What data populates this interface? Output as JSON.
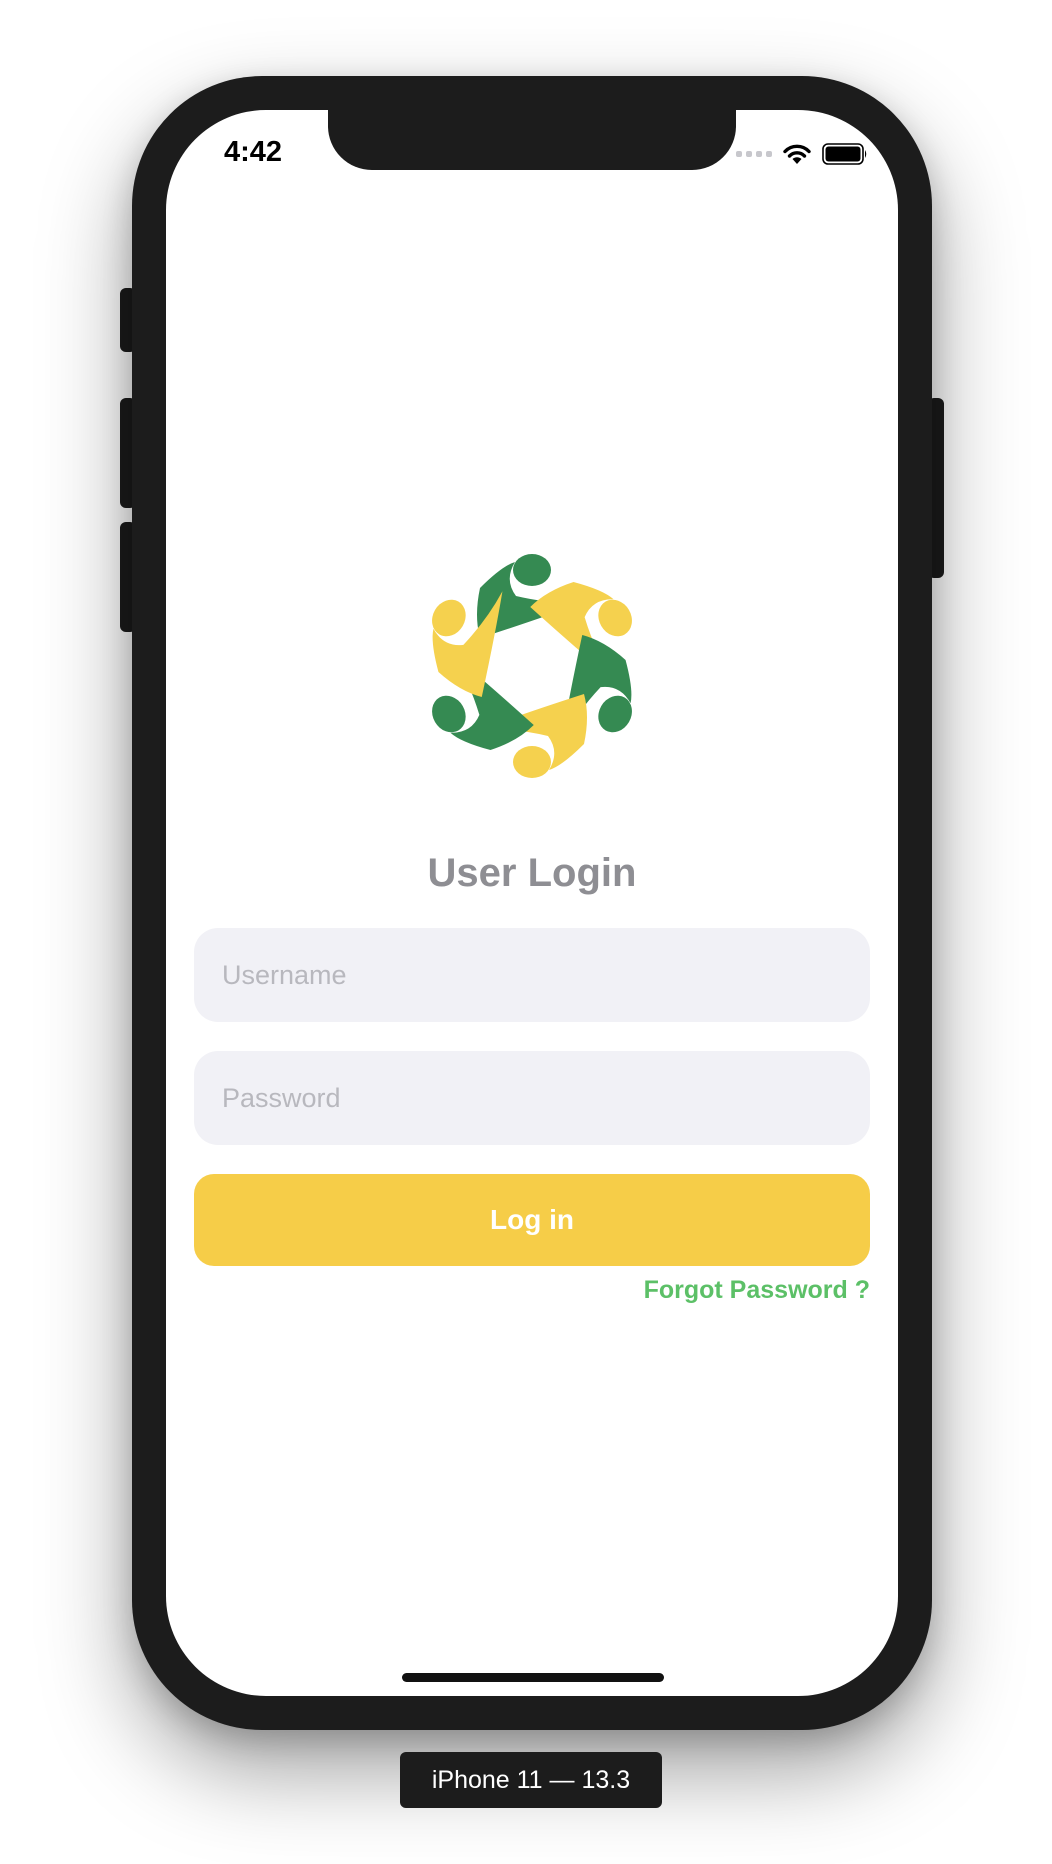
{
  "status_bar": {
    "time": "4:42",
    "signal_icon": "cellular-signal-icon",
    "wifi_icon": "wifi-icon",
    "battery_icon": "battery-icon"
  },
  "logo": {
    "icon": "people-circle-logo",
    "colors": {
      "green": "#358a52",
      "yellow": "#f5d14e"
    }
  },
  "login": {
    "title": "User Login",
    "username_placeholder": "Username",
    "username_value": "",
    "password_placeholder": "Password",
    "password_value": "",
    "login_label": "Log in",
    "forgot_label": "Forgot Password ?"
  },
  "colors": {
    "accent": "#f6cd48",
    "link": "#5cc067",
    "title": "#8e8e93",
    "field_bg": "#f1f1f6"
  },
  "simulator": {
    "device_label": "iPhone 11 — 13.3"
  }
}
